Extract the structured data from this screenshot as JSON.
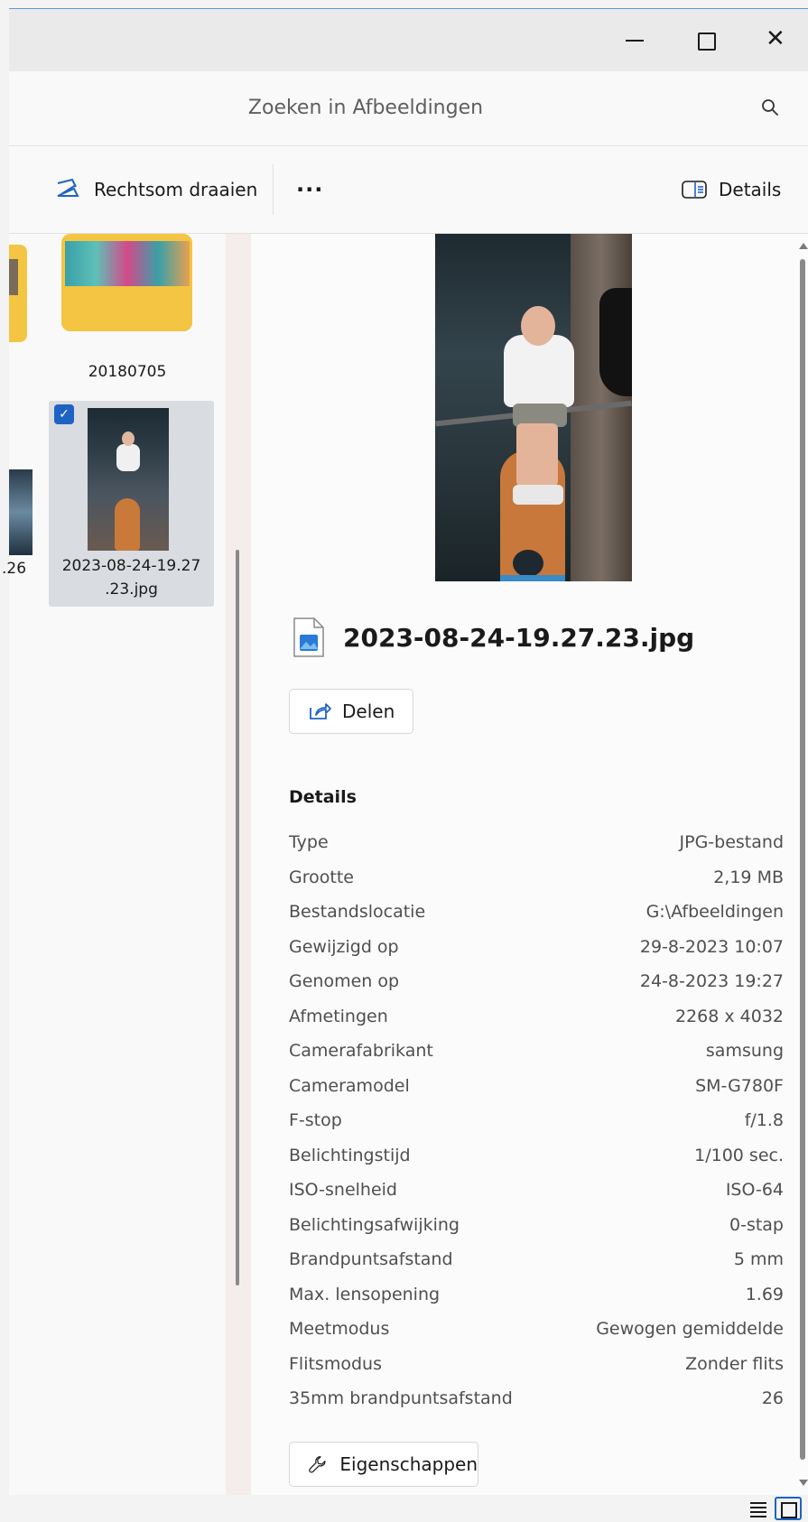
{
  "window": {
    "minimize_glyph": "—",
    "close_glyph": "✕"
  },
  "search": {
    "placeholder": "Zoeken in Afbeeldingen"
  },
  "toolbar": {
    "rotate_label": "Rechtsom draaien",
    "more_label": "···",
    "details_label": "Details"
  },
  "files": {
    "folder_name": "20180705",
    "partial_label": ".26",
    "selected_line1": "2023-08-24-19.27",
    "selected_line2": ".23.jpg",
    "checkmark": "✓"
  },
  "details_pane": {
    "filename": "2023-08-24-19.27.23.jpg",
    "share_label": "Delen",
    "section_title": "Details",
    "properties_label": "Eigenschappen",
    "rows": [
      {
        "label": "Type",
        "value": "JPG-bestand"
      },
      {
        "label": "Grootte",
        "value": "2,19 MB"
      },
      {
        "label": "Bestandslocatie",
        "value": "G:\\Afbeeldingen"
      },
      {
        "label": "Gewijzigd op",
        "value": "29-8-2023 10:07"
      },
      {
        "label": "Genomen op",
        "value": "24-8-2023 19:27"
      },
      {
        "label": "Afmetingen",
        "value": "2268 x 4032"
      },
      {
        "label": "Camerafabrikant",
        "value": "samsung"
      },
      {
        "label": "Cameramodel",
        "value": "SM-G780F"
      },
      {
        "label": "F-stop",
        "value": "f/1.8"
      },
      {
        "label": "Belichtingstijd",
        "value": "1/100 sec."
      },
      {
        "label": "ISO-snelheid",
        "value": "ISO-64"
      },
      {
        "label": "Belichtingsafwijking",
        "value": "0-stap"
      },
      {
        "label": "Brandpuntsafstand",
        "value": "5 mm"
      },
      {
        "label": "Max. lensopening",
        "value": "1.69"
      },
      {
        "label": "Meetmodus",
        "value": "Gewogen gemiddelde"
      },
      {
        "label": "Flitsmodus",
        "value": "Zonder flits"
      },
      {
        "label": "35mm brandpuntsafstand",
        "value": "26"
      }
    ]
  },
  "colors": {
    "accent": "#1e63c4",
    "folder": "#f4c542"
  }
}
